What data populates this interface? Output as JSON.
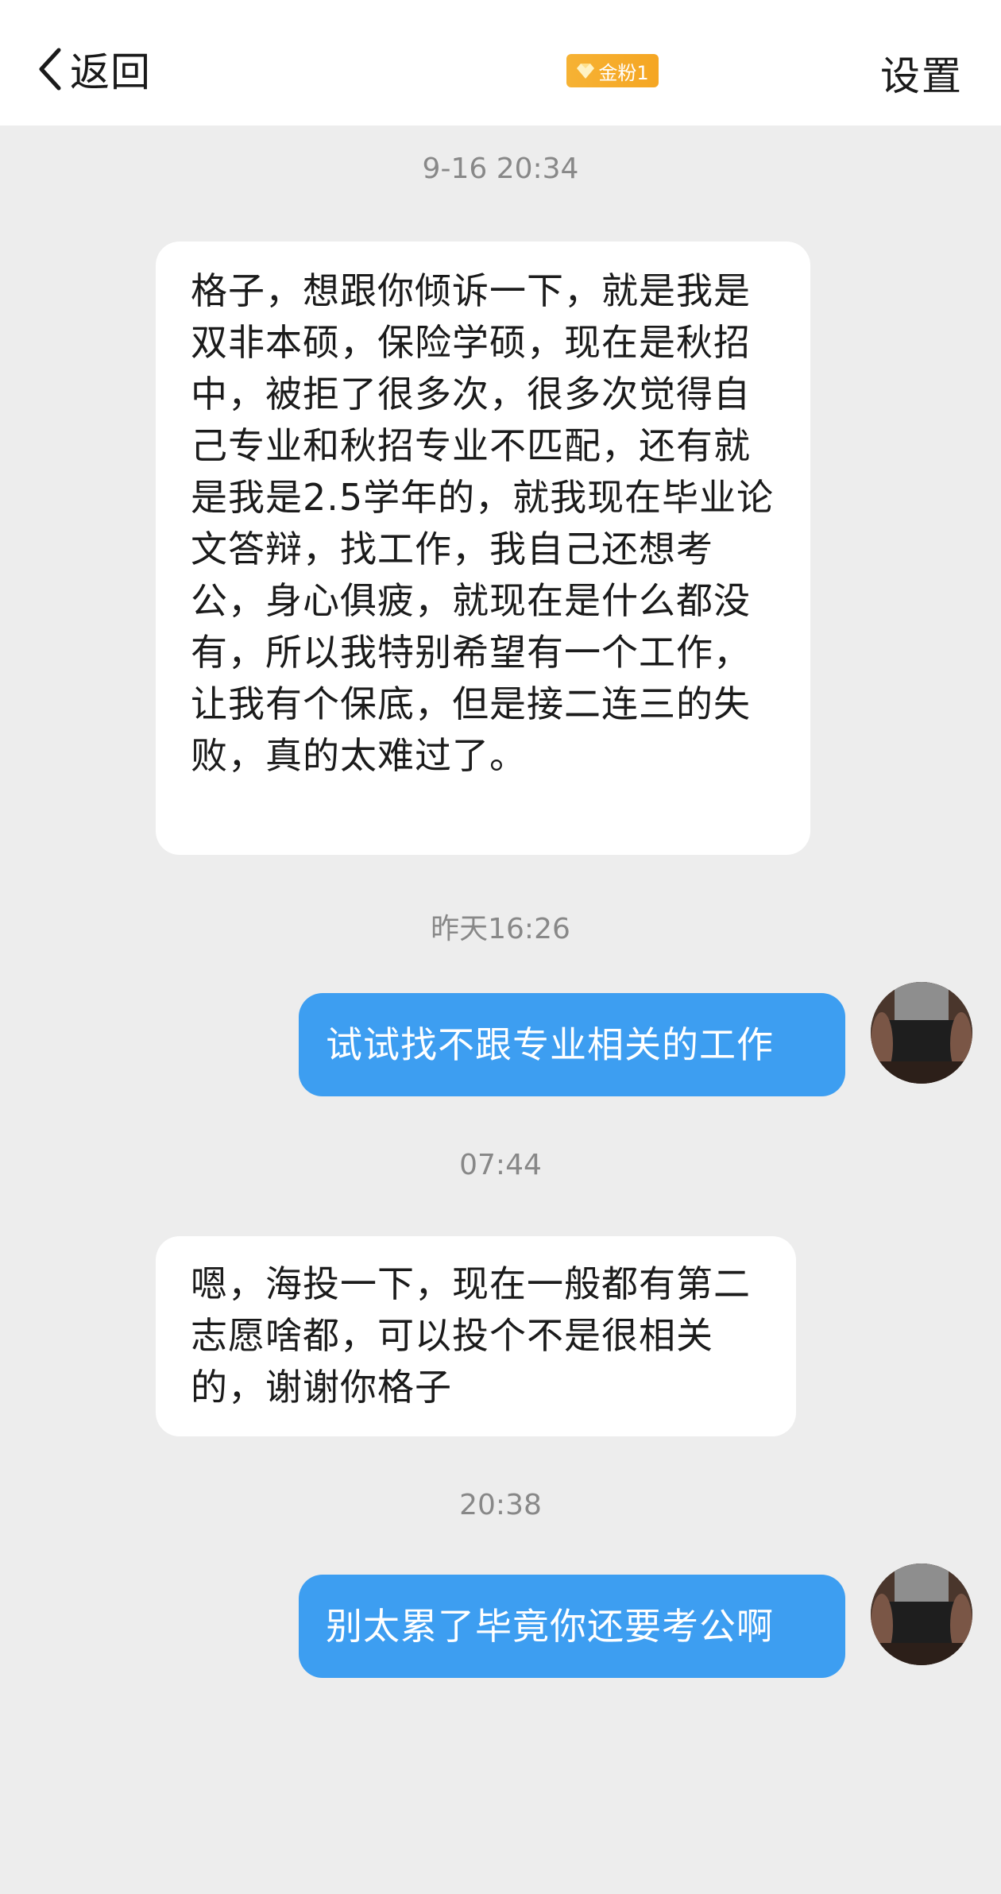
{
  "header": {
    "back_label": "返回",
    "badge_label": "金粉1",
    "settings_label": "设置",
    "badge_color": "#f5a623"
  },
  "messages": [
    {
      "timestamp": "9-16 20:34",
      "side": "incoming",
      "text": "格子，想跟你倾诉一下，就是我是双非本硕，保险学硕，现在是秋招中，被拒了很多次，很多次觉得自己专业和秋招专业不匹配，还有就是我是2.5学年的，就我现在毕业论文答辩，找工作，我自己还想考公，身心俱疲，就现在是什么都没有，所以我特别希望有一个工作，让我有个保底，但是接二连三的失败，真的太难过了。"
    },
    {
      "timestamp": "昨天16:26",
      "side": "outgoing",
      "text": "试试找不跟专业相关的工作"
    },
    {
      "timestamp": "07:44",
      "side": "incoming",
      "text": "嗯，海投一下，现在一般都有第二志愿啥都，可以投个不是很相关的，谢谢你格子"
    },
    {
      "timestamp": "20:38",
      "side": "outgoing",
      "text": "别太累了毕竟你还要考公啊"
    }
  ],
  "colors": {
    "background": "#ededed",
    "outgoing_bubble": "#3d9ef1",
    "incoming_bubble": "#ffffff"
  }
}
